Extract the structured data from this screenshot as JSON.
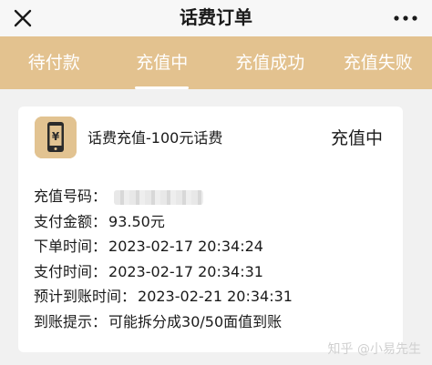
{
  "header": {
    "title": "话费订单",
    "close_icon": "close-icon",
    "more_icon": "more-icon"
  },
  "tabs": [
    {
      "label": "待付款",
      "active": false
    },
    {
      "label": "充值中",
      "active": true
    },
    {
      "label": "充值成功",
      "active": false
    },
    {
      "label": "充值失败",
      "active": false
    }
  ],
  "order": {
    "icon": "phone-yuan-icon",
    "product": "话费充值-100元话费",
    "status": "充值中",
    "rows": [
      {
        "label": "充值号码：",
        "value": ""
      },
      {
        "label": "支付金额：",
        "value": "93.50元"
      },
      {
        "label": "下单时间：",
        "value": "2023-02-17 20:34:24"
      },
      {
        "label": "支付时间：",
        "value": "2023-02-17 20:34:31"
      },
      {
        "label": "预计到账时间：",
        "value": "2023-02-21 20:34:31"
      },
      {
        "label": "到账提示：",
        "value": "可能拆分成30/50面值到账"
      }
    ]
  },
  "watermark": "知乎 @小易先生",
  "colors": {
    "accent": "#e3c28f",
    "background": "#f1f1f1"
  }
}
